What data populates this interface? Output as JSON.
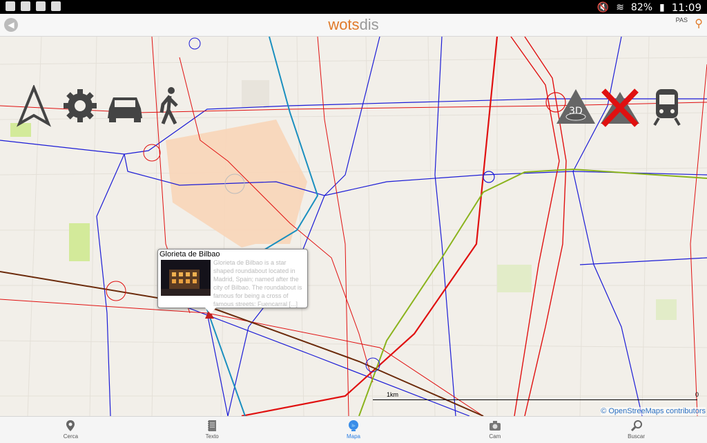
{
  "statusbar": {
    "battery": "82%",
    "time": "11:09"
  },
  "appbar": {
    "title_main": "wots",
    "title_accent": "dis",
    "network_label": "PAS"
  },
  "map": {
    "scale_label": "1km",
    "scale_zero": "0",
    "copyright": "© OpenStreeMaps contributors"
  },
  "toolbar": {
    "icons": [
      "navigation-arrow-icon",
      "settings-gear-icon",
      "car-icon",
      "walk-icon",
      "3d-view-icon",
      "no-mountain-icon",
      "train-icon"
    ]
  },
  "popup": {
    "title": "Glorieta de Bilbao",
    "text": "Glorieta de Bilbao is a star shaped roundabout located in Madrid, Spain; named after the city of Bilbao. The roundabout is famous for being a cross of famous streets: Fuencarral [...]"
  },
  "bottomnav": {
    "tabs": [
      {
        "label": "Cerca",
        "icon": "location-pin-icon",
        "active": false
      },
      {
        "label": "Texto",
        "icon": "notebook-icon",
        "active": false
      },
      {
        "label": "Mapa",
        "icon": "globe-icon",
        "active": true
      },
      {
        "label": "Cam",
        "icon": "camera-icon",
        "active": false
      },
      {
        "label": "Buscar",
        "icon": "search-icon",
        "active": false
      }
    ]
  }
}
